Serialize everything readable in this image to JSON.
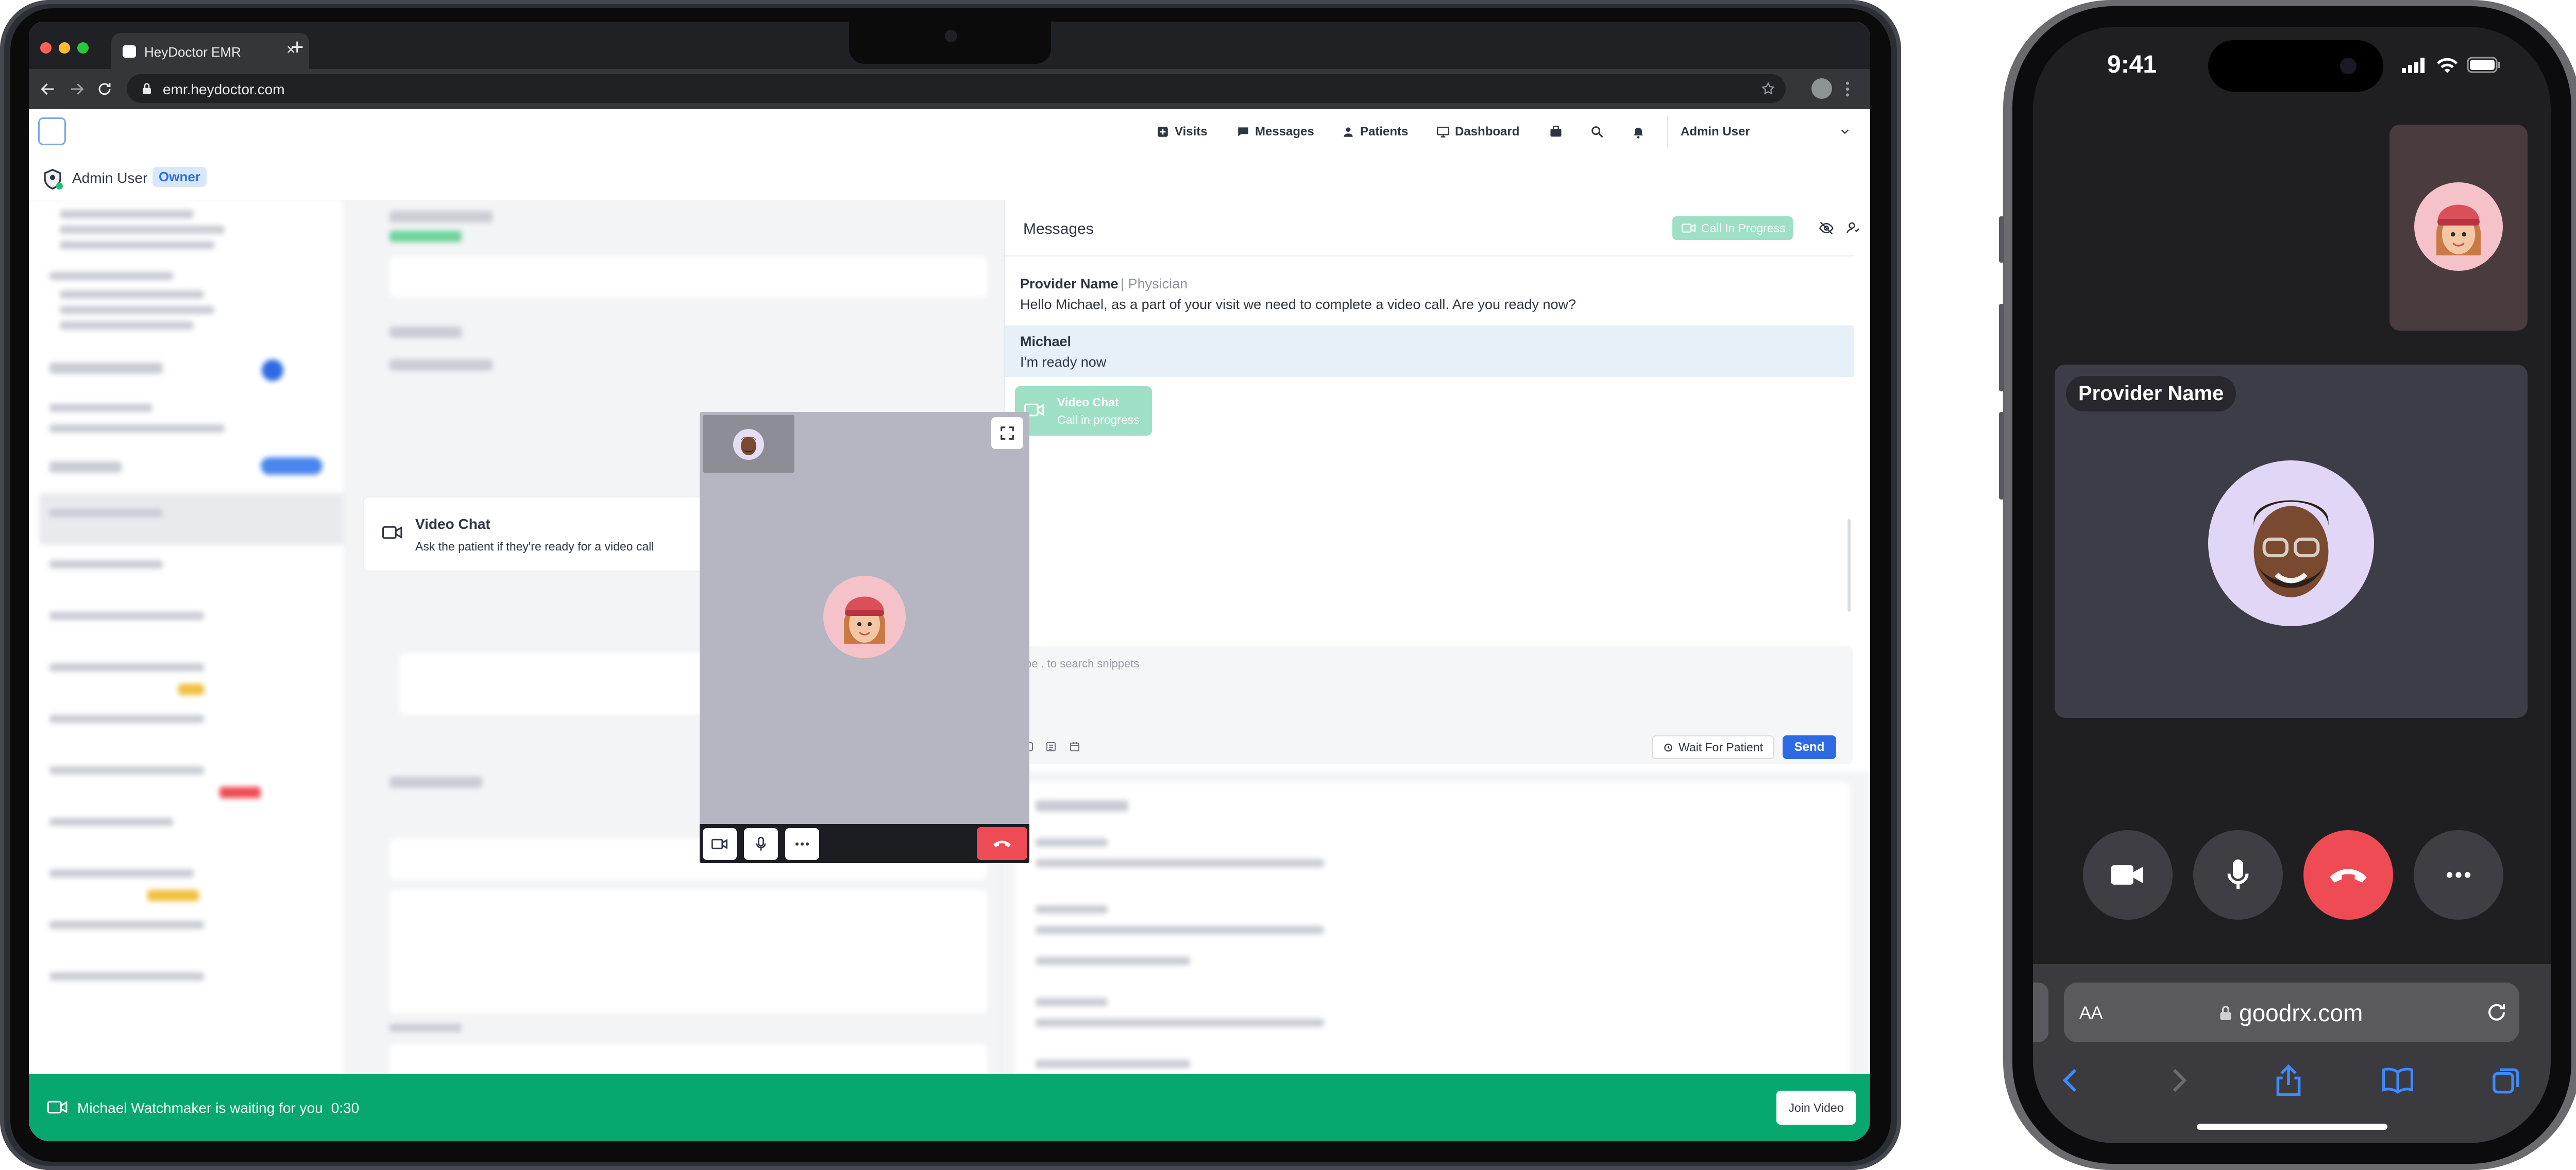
{
  "browser": {
    "tab_title": "HeyDoctor EMR",
    "tab_close": "×",
    "new_tab": "+",
    "url": "emr.heydoctor.com"
  },
  "nav": {
    "visits": "Visits",
    "messages": "Messages",
    "patients": "Patients",
    "dashboard": "Dashboard",
    "user_menu": "Admin User"
  },
  "userbar": {
    "name": "Admin User",
    "role": "Owner"
  },
  "background_panel": {
    "video_chat_title": "Video Chat",
    "video_chat_desc": "Ask the patient if they're ready for a video call"
  },
  "messages": {
    "title": "Messages",
    "status_badge": "Call In Progress",
    "items": [
      {
        "sender": "Provider Name",
        "role": "| Physician",
        "text": "Hello Michael, as a part of your visit we need to complete a video call. Are you ready now?"
      },
      {
        "sender": "Michael",
        "text": "I'm ready now"
      }
    ],
    "video_card": {
      "title": "Video Chat",
      "subtitle": "Call in progress"
    },
    "composer_placeholder": "pe . to search snippets",
    "wait_button": "Wait For Patient",
    "send_button": "Send"
  },
  "waitbar": {
    "text": "Michael Watchmaker is waiting for you",
    "timer": "0:30",
    "join_button": "Join Video"
  },
  "phone": {
    "time": "9:41",
    "provider_label": "Provider Name",
    "address_aa": "AA",
    "address_url": "goodrx.com"
  },
  "colors": {
    "brand_blue": "#2d6be4",
    "success_green": "#06a86f",
    "call_badge": "#9ee0c6",
    "hangup_red": "#ef4b55"
  },
  "icons": {
    "camera": "video-camera-icon",
    "mic": "microphone-icon",
    "more": "more-icon",
    "hangup": "phone-hangup-icon"
  }
}
